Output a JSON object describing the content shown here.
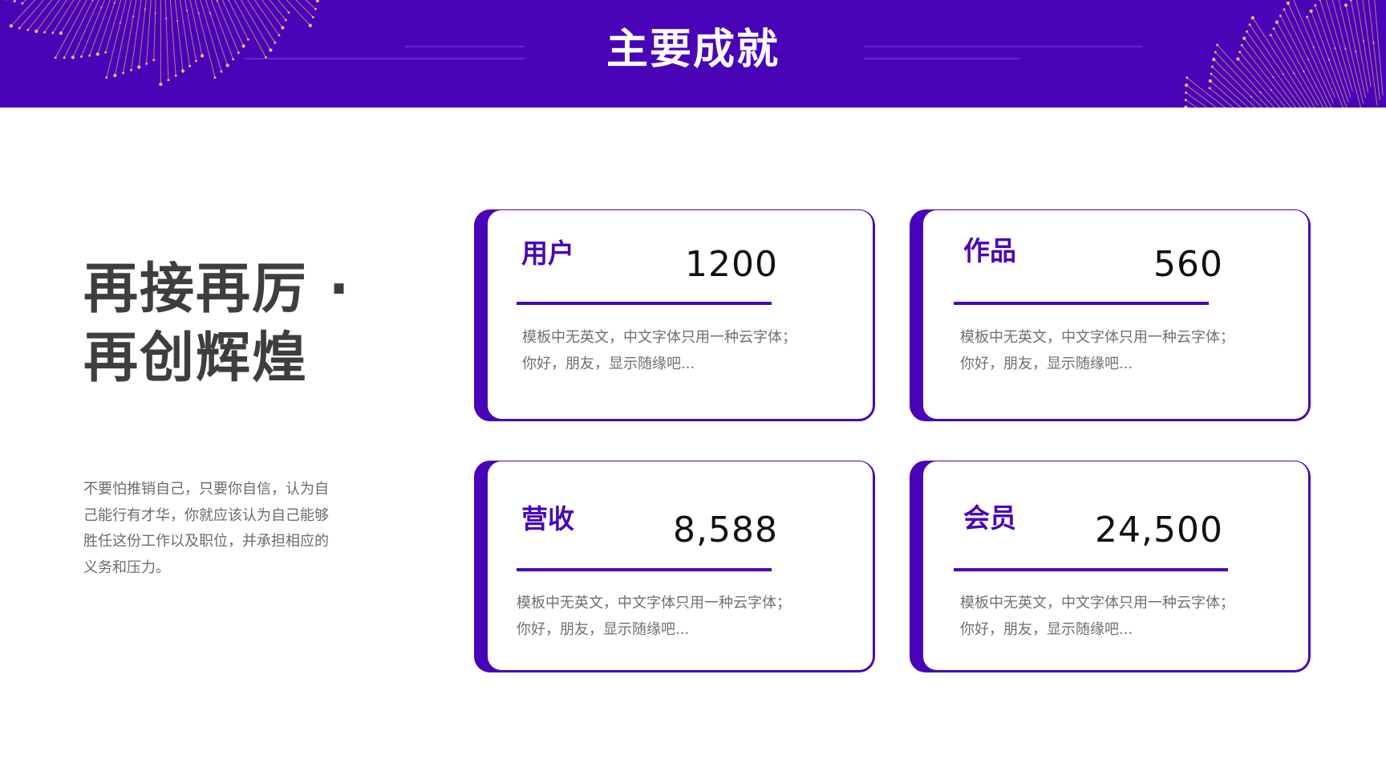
{
  "header": {
    "title": "主要成就"
  },
  "hero": {
    "slogan_line1": "再接再厉 ·",
    "slogan_line2": "再创辉煌",
    "intro": "不要怕推销自己，只要你自信，认为自己能行有才华，你就应该认为自己能够胜任这份工作以及职位，并承担相应的义务和压力。"
  },
  "cards": [
    {
      "label": "用户",
      "value": "1200",
      "description": "模板中无英文，中文字体只用一种云字体；你好，朋友，显示随缘吧..."
    },
    {
      "label": "作品",
      "value": "560",
      "description": "模板中无英文，中文字体只用一种云字体；你好，朋友，显示随缘吧..."
    },
    {
      "label": "营收",
      "value": "8,588",
      "description": "模板中无英文，中文字体只用一种云字体；你好，朋友，显示随缘吧..."
    },
    {
      "label": "会员",
      "value": "24,500",
      "description": "模板中无英文，中文字体只用一种云字体；你好，朋友，显示随缘吧..."
    }
  ],
  "colors": {
    "accent": "#4a04b8",
    "gold": "#e6b36a",
    "text_dark": "#3e3e3e",
    "text_muted": "#6f6f6f"
  },
  "icons": {
    "left_decor": "golden-dot-arc-decoration",
    "right_decor": "golden-dot-arc-decoration"
  }
}
